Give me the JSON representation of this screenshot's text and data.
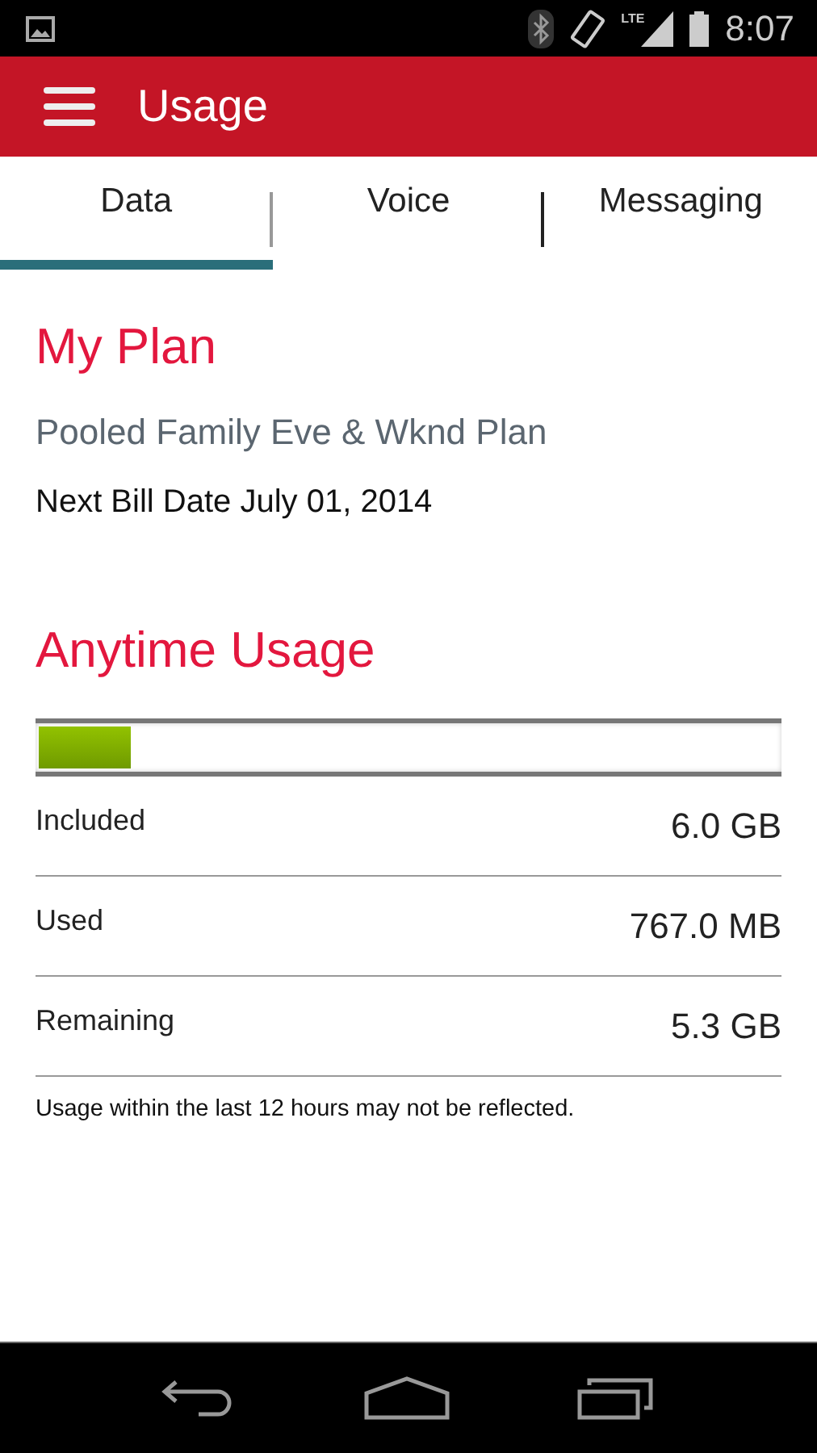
{
  "status_bar": {
    "network": "LTE",
    "time": "8:07"
  },
  "app_bar": {
    "title": "Usage"
  },
  "tabs": [
    {
      "label": "Data",
      "selected": true
    },
    {
      "label": "Voice",
      "selected": false
    },
    {
      "label": "Messaging",
      "selected": false
    }
  ],
  "plan": {
    "heading": "My Plan",
    "name": "Pooled Family Eve & Wknd Plan",
    "bill_date": "Next Bill Date July 01, 2014"
  },
  "usage": {
    "heading": "Anytime Usage",
    "level": 0.125,
    "rows": [
      {
        "label": "Included",
        "value": "6.0 GB"
      },
      {
        "label": "Used",
        "value": "767.0 MB"
      },
      {
        "label": "Remaining",
        "value": "5.3 GB"
      }
    ],
    "note": "Usage within the last 12 hours may not be reflected."
  }
}
